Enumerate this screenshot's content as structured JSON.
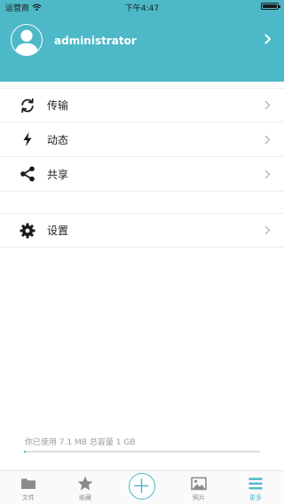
{
  "status_bar": {
    "carrier": "运营商",
    "time": "下午4:47"
  },
  "profile": {
    "username": "administrator"
  },
  "menu": {
    "group1": [
      {
        "label": "传输",
        "icon": "sync-icon"
      },
      {
        "label": "动态",
        "icon": "lightning-icon"
      },
      {
        "label": "共享",
        "icon": "share-icon"
      }
    ],
    "group2": [
      {
        "label": "设置",
        "icon": "gear-icon"
      }
    ]
  },
  "storage": {
    "text": "你已使用 7.1 MB 总容量 1 GB",
    "used_fraction": 0.007
  },
  "tabs": [
    {
      "label": "文件",
      "icon": "folder-icon"
    },
    {
      "label": "收藏",
      "icon": "star-icon"
    },
    {
      "label": "照片",
      "icon": "image-icon"
    },
    {
      "label": "更多",
      "icon": "menu-icon"
    }
  ],
  "colors": {
    "accent": "#4db8c7",
    "tab_inactive": "#8c8c8c",
    "text": "#222222"
  }
}
